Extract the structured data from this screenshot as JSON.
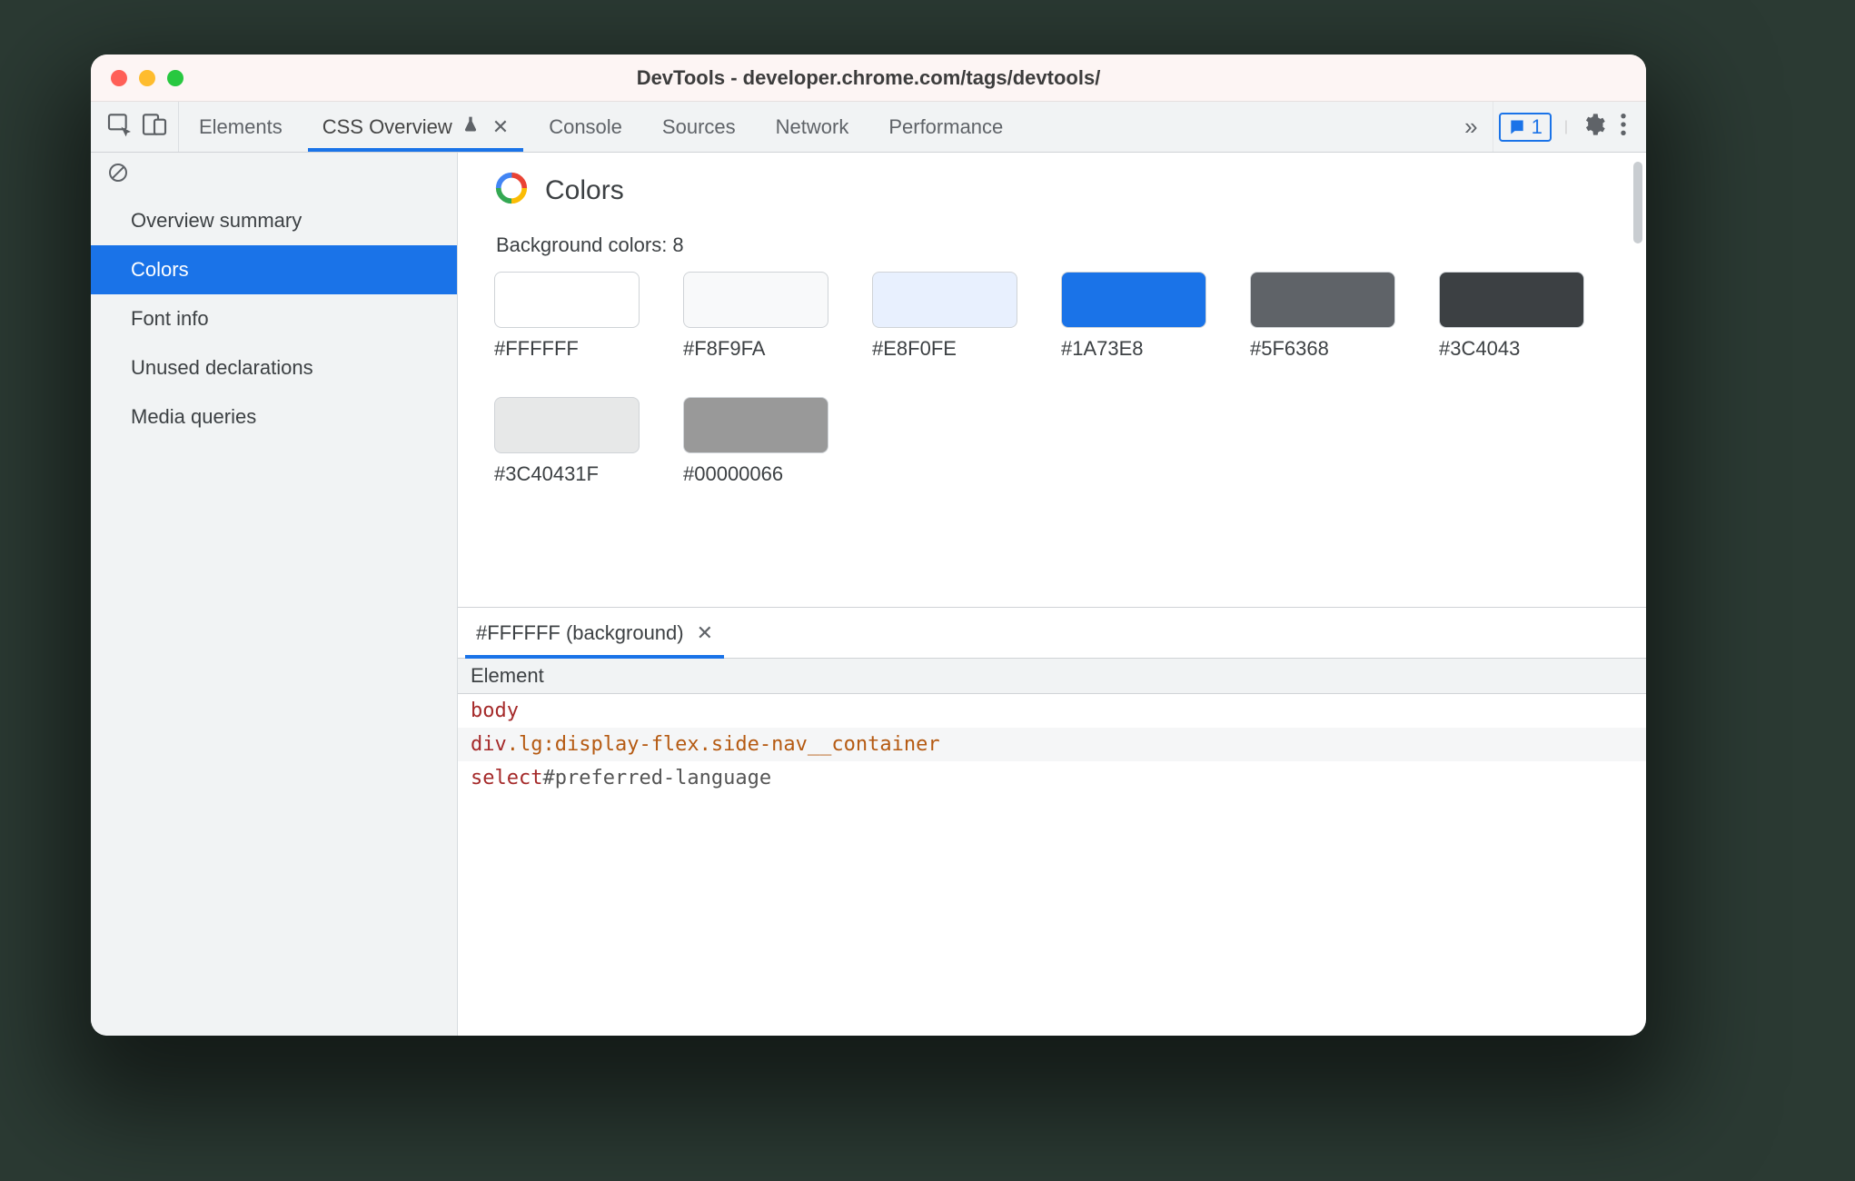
{
  "window": {
    "title": "DevTools - developer.chrome.com/tags/devtools/"
  },
  "tabs": {
    "items": [
      "Elements",
      "CSS Overview",
      "Console",
      "Sources",
      "Network",
      "Performance"
    ],
    "active_index": 1,
    "more_glyph": "»"
  },
  "issues": {
    "count": "1"
  },
  "sidebar": {
    "items": [
      "Overview summary",
      "Colors",
      "Font info",
      "Unused declarations",
      "Media queries"
    ],
    "active_index": 1
  },
  "panel": {
    "title": "Colors",
    "section_label": "Background colors: 8",
    "swatches": [
      {
        "hex": "#FFFFFF",
        "css": "#FFFFFF"
      },
      {
        "hex": "#F8F9FA",
        "css": "#F8F9FA"
      },
      {
        "hex": "#E8F0FE",
        "css": "#E8F0FE"
      },
      {
        "hex": "#1A73E8",
        "css": "#1A73E8"
      },
      {
        "hex": "#5F6368",
        "css": "#5F6368"
      },
      {
        "hex": "#3C4043",
        "css": "#3C4043"
      },
      {
        "hex": "#3C40431F",
        "css": "rgba(60,64,67,0.12)"
      },
      {
        "hex": "#00000066",
        "css": "rgba(0,0,0,0.40)"
      }
    ]
  },
  "drawer": {
    "tab_label": "#FFFFFF (background)",
    "column": "Element",
    "rows": [
      [
        {
          "t": "tagn",
          "v": "body"
        }
      ],
      [
        {
          "t": "tagn",
          "v": "div"
        },
        {
          "t": "cls",
          "v": ".lg:display-flex.side-nav__container"
        }
      ],
      [
        {
          "t": "tagn",
          "v": "select"
        },
        {
          "t": "sel",
          "v": "#preferred-language"
        }
      ]
    ]
  }
}
